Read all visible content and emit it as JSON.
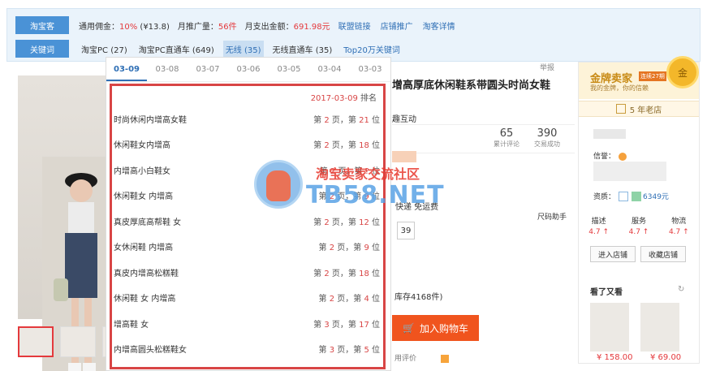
{
  "topbar": {
    "tag1": "淘宝客",
    "commission": "通用佣金：",
    "commission_value": "10%",
    "commission_amount": "(¥13.8)",
    "monthly_promo": "月推广量：",
    "monthly_promo_value": "56件",
    "monthly_spend": "月支出金额：",
    "monthly_spend_value": "691.98元",
    "links": [
      "联盟链接",
      "店铺推广",
      "淘客详情"
    ],
    "tag2": "关键词",
    "keywords": [
      "淘宝PC (27)",
      "淘宝PC直通车 (649)",
      "无线 (35)",
      "无线直通车 (35)",
      "Top20万关键词"
    ]
  },
  "popup": {
    "dates": [
      "03-09",
      "03-08",
      "03-07",
      "03-06",
      "03-05",
      "03-04",
      "03-03"
    ],
    "head_date": "2017-03-09",
    "head_label": "排名",
    "rows": [
      {
        "kw": "时尚休闲内增高女鞋",
        "page": "2",
        "pos": "21"
      },
      {
        "kw": "休闲鞋女内增高",
        "page": "2",
        "pos": "18"
      },
      {
        "kw": "内增高小白鞋女",
        "page": "2",
        "pos": "?"
      },
      {
        "kw": "休闲鞋女 内增高",
        "page": "2",
        "pos": "9"
      },
      {
        "kw": "真皮厚底高帮鞋 女",
        "page": "2",
        "pos": "12"
      },
      {
        "kw": "女休闲鞋 内增高",
        "page": "2",
        "pos": "9"
      },
      {
        "kw": "真皮内增高松糕鞋",
        "page": "2",
        "pos": "18"
      },
      {
        "kw": "休闲鞋 女 内增高",
        "page": "2",
        "pos": "4"
      },
      {
        "kw": "增高鞋 女",
        "page": "3",
        "pos": "17"
      },
      {
        "kw": "内增高圆头松糕鞋女",
        "page": "3",
        "pos": "5"
      }
    ],
    "rank_prefix": "第",
    "page_suffix": "页，第",
    "pos_suffix": "位"
  },
  "product": {
    "report": "举报",
    "title": "增高厚底休闲鞋系带圆头时尚女鞋",
    "hudong": "趣互动",
    "stats": [
      {
        "n": "65",
        "l": "累计评论"
      },
      {
        "n": "390",
        "l": "交易成功"
      }
    ],
    "kuaidi": "快递 免运费",
    "size_helper": "尺码助手",
    "size": "39",
    "stock": "库存4168件)",
    "cart": "加入购物车",
    "bottom": "用评价"
  },
  "shop": {
    "gold": "金牌卖家",
    "badge": "连续27期",
    "gold_sub": "我的金牌，你的信赖",
    "medal": "金",
    "old": "5 年老店",
    "xinyu": "信誉：",
    "zizhi": "资质：",
    "deposit": "6349元",
    "dsr": [
      {
        "k": "描述",
        "v": "4.7 ↑"
      },
      {
        "k": "服务",
        "v": "4.7 ↑"
      },
      {
        "k": "物流",
        "v": "4.7 ↑"
      }
    ],
    "enter": "进入店铺",
    "fav": "收藏店铺",
    "also": "看了又看",
    "prices": [
      "¥ 158.00",
      "¥ 69.00"
    ]
  },
  "watermark": {
    "t1": "淘宝卖家交流社区",
    "t2": "TB58.NET"
  }
}
